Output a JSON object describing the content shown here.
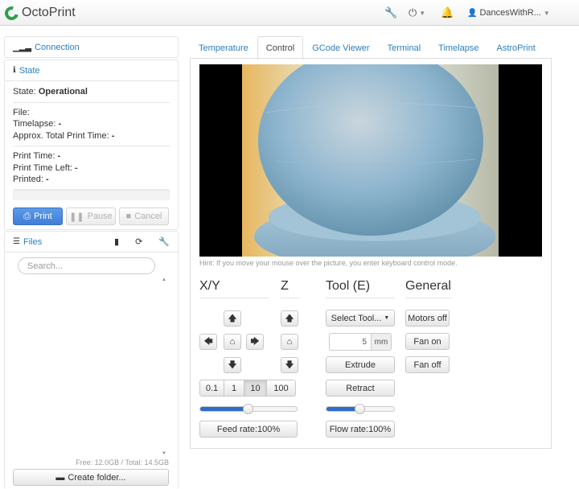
{
  "navbar": {
    "brand": "OctoPrint",
    "user": "DancesWithR..."
  },
  "connection": {
    "title": "Connection"
  },
  "state": {
    "title": "State",
    "state_label": "State:",
    "state_value": "Operational",
    "file_label": "File:",
    "timelapse_label": "Timelapse:",
    "timelapse_value": "-",
    "approx_label": "Approx. Total Print Time:",
    "approx_value": "-",
    "print_time_label": "Print Time:",
    "print_time_value": "-",
    "print_time_left_label": "Print Time Left:",
    "print_time_left_value": "-",
    "printed_label": "Printed:",
    "printed_value": "-",
    "progress_percent": 0,
    "print_label": "Print",
    "pause_label": "Pause",
    "cancel_label": "Cancel"
  },
  "files": {
    "title": "Files",
    "search_placeholder": "Search...",
    "free_total": "Free: 12.0GB / Total: 14.5GB",
    "create_folder_label": "Create folder..."
  },
  "tabs": [
    {
      "label": "Temperature"
    },
    {
      "label": "Control"
    },
    {
      "label": "GCode Viewer"
    },
    {
      "label": "Terminal"
    },
    {
      "label": "Timelapse"
    },
    {
      "label": "AstroPrint"
    }
  ],
  "active_tab": "Control",
  "webcam": {
    "hint": "Hint: If you move your mouse over the picture, you enter keyboard control mode."
  },
  "control": {
    "xy_title": "X/Y",
    "z_title": "Z",
    "tool_title": "Tool (E)",
    "general_title": "General",
    "steps": [
      "0.1",
      "1",
      "10",
      "100"
    ],
    "active_step": "10",
    "select_tool_label": "Select Tool...",
    "extrude_amount": "5",
    "extrude_unit": "mm",
    "extrude_label": "Extrude",
    "retract_label": "Retract",
    "feed_rate_label": "Feed rate:100%",
    "feed_rate_percent": 100,
    "flow_rate_label": "Flow rate:100%",
    "flow_rate_percent": 100,
    "motors_off_label": "Motors off",
    "fan_on_label": "Fan on",
    "fan_off_label": "Fan off"
  },
  "icons": {
    "xy_up": "arrow-up-icon",
    "xy_left": "arrow-left-icon",
    "xy_home": "home-icon",
    "xy_right": "arrow-right-icon",
    "xy_down": "arrow-down-icon",
    "z_up": "arrow-up-icon",
    "z_home": "home-icon",
    "z_down": "arrow-down-icon"
  },
  "colors": {
    "accent": "#2a7fc1",
    "primary_button": "#4a8be0",
    "slider_fill": "#2f6cc6",
    "logo_green": "#2aa14a"
  }
}
